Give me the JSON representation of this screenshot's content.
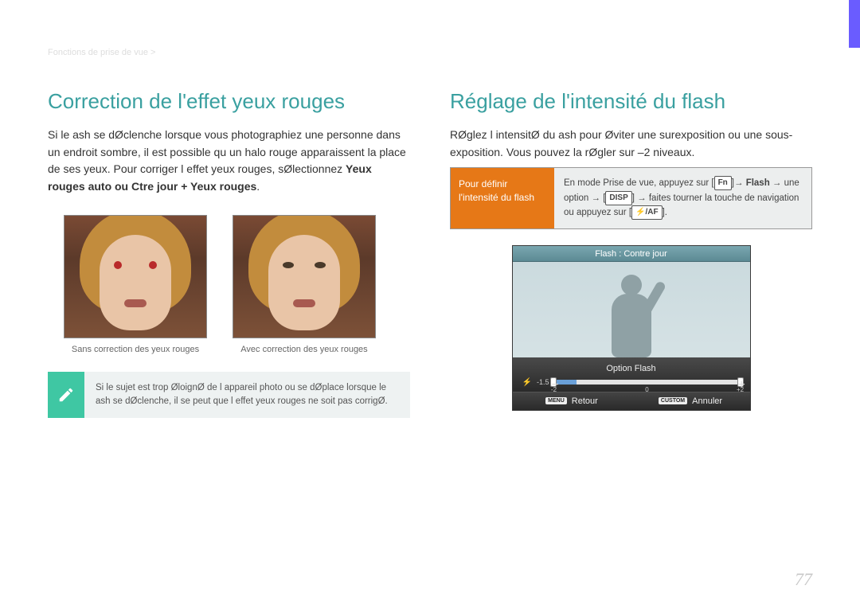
{
  "breadcrumb": "Fonctions de prise de vue >",
  "page_number": "77",
  "left": {
    "title": "Correction de l'effet yeux rouges",
    "paragraph": "Si le ash se dØclenche lorsque vous photographiez une personne dans un endroit sombre, il est possible qu un halo rouge apparaissent   la place de ses yeux. Pour corriger l effet yeux rouges, sØlectionnez ",
    "strong": "Yeux rouges auto ou Ctre jour + Yeux rouges",
    "period": ".",
    "caption_without": "Sans correction des yeux rouges",
    "caption_with": "Avec correction des yeux rouges",
    "note": "Si le sujet est trop ØloignØ de l appareil photo ou se dØplace lorsque le ash se dØclenche, il se peut que l effet yeux rouges ne soit pas corrigØ."
  },
  "right": {
    "title": "Réglage de l'intensité du flash",
    "paragraph": "RØglez l intensitØ du ash pour Øviter une surexposition ou une sous-exposition. Vous pouvez la rØgler sur –2 niveaux.",
    "instr_left": "Pour définir l'intensité du flash",
    "instr_prefix": "En mode Prise de vue, appuyez sur [",
    "instr_fn": "Fn",
    "instr_mid1": "]→ ",
    "instr_flash": "Flash",
    "instr_mid2": " → une option → [",
    "instr_disp": "DISP",
    "instr_mid3": "] → faites tourner la touche de navigation ou appuyez sur [",
    "instr_af": "⚡/AF",
    "instr_end": "].",
    "camera": {
      "title": "Flash : Contre jour",
      "option": "Option Flash",
      "value": "-1.5",
      "ticks": {
        "low": "-2",
        "mid": "0",
        "high": "+2"
      },
      "btn_menu": "MENU",
      "btn_menu_label": "Retour",
      "btn_custom": "CUSTOM",
      "btn_custom_label": "Annuler"
    }
  }
}
